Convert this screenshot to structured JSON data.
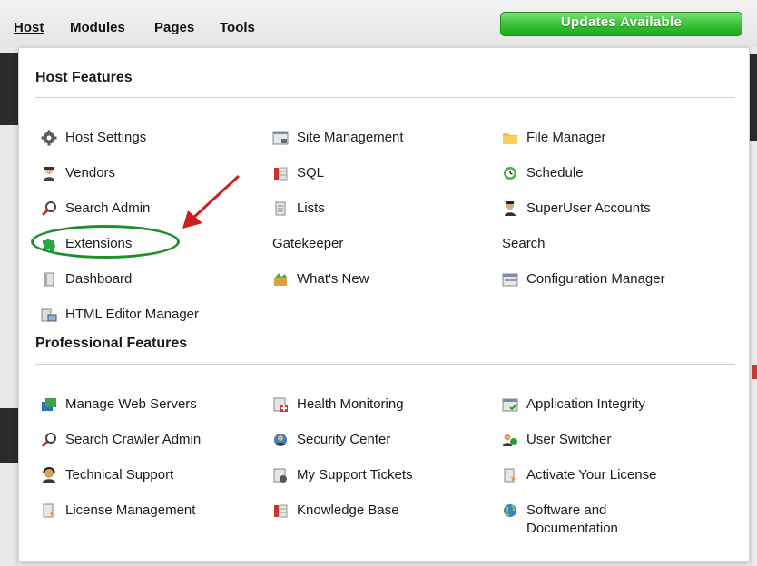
{
  "menubar": {
    "items": [
      {
        "label": "Host",
        "active": true
      },
      {
        "label": "Modules"
      },
      {
        "label": "Pages"
      },
      {
        "label": "Tools"
      }
    ],
    "updates_label": "Updates Available",
    "updates_color": "#2fb62c"
  },
  "host_features": {
    "title": "Host Features",
    "columns": [
      [
        {
          "label": "Host Settings",
          "icon": "gear-icon"
        },
        {
          "label": "Vendors",
          "icon": "vendor-icon"
        },
        {
          "label": "Search Admin",
          "icon": "magnifier-icon"
        },
        {
          "label": "Extensions",
          "icon": "puzzle-icon"
        },
        {
          "label": "Dashboard",
          "icon": "document-icon"
        },
        {
          "label": "HTML Editor Manager",
          "icon": "html-editor-icon"
        }
      ],
      [
        {
          "label": "Site Management",
          "icon": "site-icon"
        },
        {
          "label": "SQL",
          "icon": "database-icon"
        },
        {
          "label": "Lists",
          "icon": "list-icon"
        },
        {
          "label": "Gatekeeper",
          "icon": ""
        },
        {
          "label": "What's New",
          "icon": "news-icon"
        }
      ],
      [
        {
          "label": "File Manager",
          "icon": "folder-icon"
        },
        {
          "label": "Schedule",
          "icon": "schedule-icon"
        },
        {
          "label": "SuperUser Accounts",
          "icon": "superuser-icon"
        },
        {
          "label": "Search",
          "icon": ""
        },
        {
          "label": "Configuration Manager",
          "icon": "config-icon"
        }
      ]
    ]
  },
  "professional_features": {
    "title": "Professional Features",
    "columns": [
      [
        {
          "label": "Manage Web Servers",
          "icon": "servers-icon"
        },
        {
          "label": "Search Crawler Admin",
          "icon": "magnifier-icon"
        },
        {
          "label": "Technical Support",
          "icon": "support-icon"
        },
        {
          "label": "License Management",
          "icon": "license-icon"
        }
      ],
      [
        {
          "label": "Health Monitoring",
          "icon": "health-icon"
        },
        {
          "label": "Security Center",
          "icon": "security-icon"
        },
        {
          "label": "My Support Tickets",
          "icon": "tickets-icon"
        },
        {
          "label": "Knowledge Base",
          "icon": "database-icon"
        }
      ],
      [
        {
          "label": "Application Integrity",
          "icon": "integrity-icon"
        },
        {
          "label": "User Switcher",
          "icon": "user-switch-icon"
        },
        {
          "label": "Activate Your License",
          "icon": "license-icon"
        },
        {
          "label": "Software and Documentation",
          "icon": "globe-icon"
        }
      ]
    ]
  },
  "annotation": {
    "highlight_color": "#1f8f2b",
    "arrow_color": "#cc1f1f"
  }
}
